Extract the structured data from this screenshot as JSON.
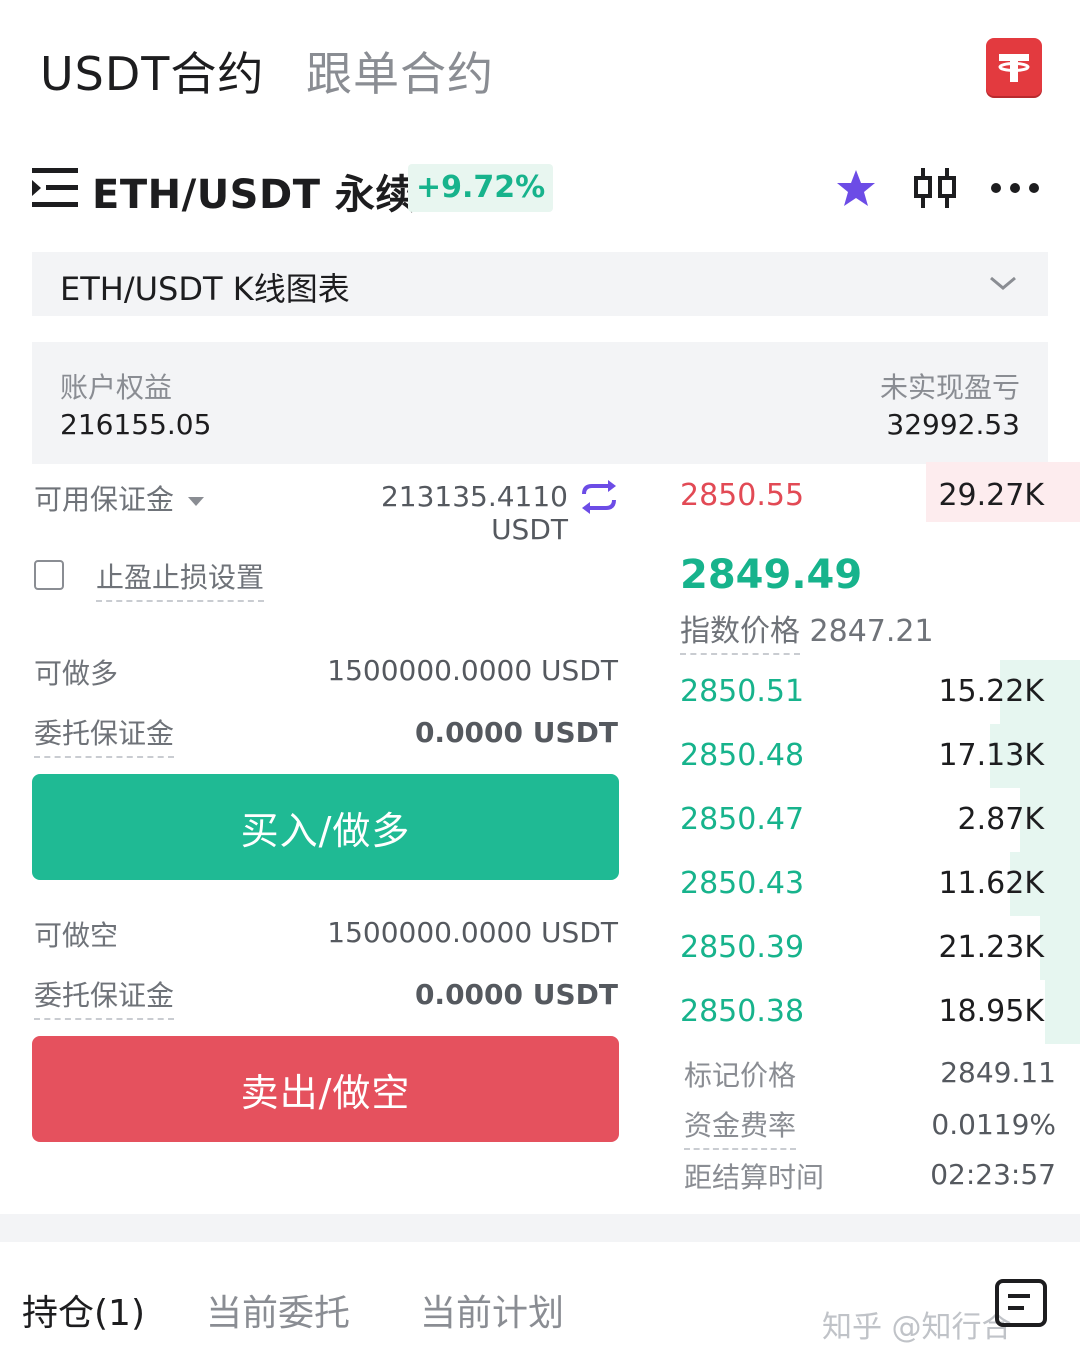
{
  "top_tabs": [
    {
      "label": "USDT合约",
      "active": true
    },
    {
      "label": "跟单合约",
      "active": false
    }
  ],
  "pair": {
    "title": "ETH/USDT 永续",
    "change": "+9.72%"
  },
  "chart_dropdown": {
    "label": "ETH/USDT K线图表"
  },
  "account": {
    "equity_label": "账户权益",
    "equity_value": "216155.05",
    "unrealized_label": "未实现盈亏",
    "unrealized_value": "32992.53"
  },
  "order_form": {
    "available_margin_label": "可用保证金",
    "available_margin_value": "213135.4110 USDT",
    "tp_sl_label": "止盈止损设置",
    "can_long_label": "可做多",
    "can_long_value": "1500000.0000 USDT",
    "long_margin_label": "委托保证金",
    "long_margin_value": "0.0000 USDT",
    "buy_button": "买入/做多",
    "can_short_label": "可做空",
    "can_short_value": "1500000.0000 USDT",
    "short_margin_label": "委托保证金",
    "short_margin_value": "0.0000 USDT",
    "sell_button": "卖出/做空"
  },
  "order_book": {
    "asks": [
      {
        "price": "2850.55",
        "size": "29.27K"
      }
    ],
    "last_price": "2849.49",
    "index_price_label": "指数价格",
    "index_price_value": "2847.21",
    "bids": [
      {
        "price": "2850.51",
        "size": "15.22K"
      },
      {
        "price": "2850.48",
        "size": "17.13K"
      },
      {
        "price": "2850.47",
        "size": "2.87K"
      },
      {
        "price": "2850.43",
        "size": "11.62K"
      },
      {
        "price": "2850.39",
        "size": "21.23K"
      },
      {
        "price": "2850.38",
        "size": "18.95K"
      }
    ]
  },
  "market_info": {
    "mark_price_label": "标记价格",
    "mark_price_value": "2849.11",
    "funding_rate_label": "资金费率",
    "funding_rate_value": "0.0119%",
    "settlement_label": "距结算时间",
    "settlement_value": "02:23:57"
  },
  "bottom_tabs": [
    {
      "label": "持仓(1)",
      "active": true
    },
    {
      "label": "当前委托",
      "active": false
    },
    {
      "label": "当前计划",
      "active": false
    }
  ],
  "watermark": "知乎 @知行合一",
  "colors": {
    "up_green": "#17b38c",
    "buy_green": "#1fba94",
    "sell_red": "#e5515e",
    "ask_red": "#e24a55",
    "accent_purple": "#6c4ce6",
    "tether_red": "#e33a3f"
  }
}
